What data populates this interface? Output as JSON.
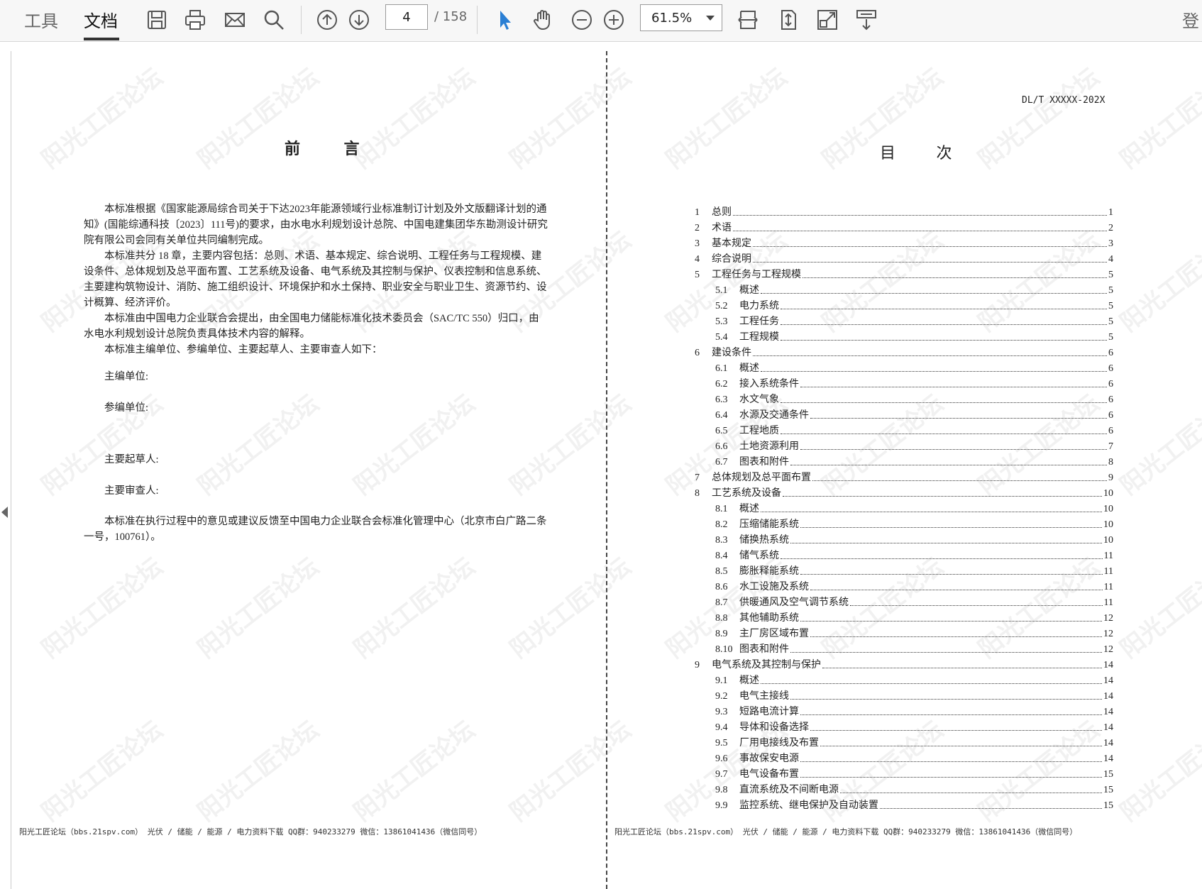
{
  "toolbar": {
    "tab_tools": "工具",
    "tab_document": "文档",
    "page_current": "4",
    "page_total": "/ 158",
    "zoom": "61.5%",
    "login": "登"
  },
  "icons": [
    "save-icon",
    "print-icon",
    "mail-icon",
    "search-icon",
    "prev-page-icon",
    "next-page-icon",
    "pointer-icon",
    "hand-icon",
    "zoom-out-icon",
    "zoom-in-icon",
    "fit-width-icon",
    "fit-page-icon",
    "fullscreen-icon",
    "scroll-icon"
  ],
  "left_page": {
    "title": "前 言",
    "paragraphs": [
      "本标准根据《国家能源局综合司关于下达2023年能源领域行业标准制订计划及外文版翻译计划的通知》(国能综通科技〔2023〕111号)的要求，由水电水利规划设计总院、中国电建集团华东勘测设计研究院有限公司会同有关单位共同编制完成。",
      "本标准共分 18 章，主要内容包括：总则、术语、基本规定、综合说明、工程任务与工程规模、建设条件、总体规划及总平面布置、工艺系统及设备、电气系统及其控制与保护、仪表控制和信息系统、主要建构筑物设计、消防、施工组织设计、环境保护和水土保持、职业安全与职业卫生、资源节约、设计概算、经济评价。",
      "本标准由中国电力企业联合会提出，由全国电力储能标准化技术委员会（SAC/TC 550）归口，由水电水利规划设计总院负责具体技术内容的解释。",
      "本标准主编单位、参编单位、主要起草人、主要审查人如下："
    ],
    "label_chief_unit": "主编单位:",
    "label_participating_units": "参编单位:",
    "label_drafters": "主要起草人:",
    "label_reviewers": "主要审查人:",
    "feedback": "本标准在执行过程中的意见或建议反馈至中国电力企业联合会标准化管理中心（北京市白广路二条一号，100761）。",
    "footer": "阳光工匠论坛（bbs.21spv.com）   光伏 / 储能 / 能源 / 电力资料下载   QQ群：940233279      微信：13861041436（微信同号）"
  },
  "right_page": {
    "std_no": "DL/T XXXXX-202X",
    "title": "目 次",
    "toc": [
      {
        "num": "1",
        "title": "总则",
        "page": "1",
        "level": 1
      },
      {
        "num": "2",
        "title": "术语",
        "page": "2",
        "level": 1
      },
      {
        "num": "3",
        "title": "基本规定",
        "page": "3",
        "level": 1
      },
      {
        "num": "4",
        "title": "综合说明",
        "page": "4",
        "level": 1
      },
      {
        "num": "5",
        "title": "工程任务与工程规模",
        "page": "5",
        "level": 1
      },
      {
        "num": "5.1",
        "title": "概述",
        "page": "5",
        "level": 2
      },
      {
        "num": "5.2",
        "title": "电力系统",
        "page": "5",
        "level": 2
      },
      {
        "num": "5.3",
        "title": "工程任务",
        "page": "5",
        "level": 2
      },
      {
        "num": "5.4",
        "title": "工程规模",
        "page": "5",
        "level": 2
      },
      {
        "num": "6",
        "title": "建设条件",
        "page": "6",
        "level": 1
      },
      {
        "num": "6.1",
        "title": "概述",
        "page": "6",
        "level": 2
      },
      {
        "num": "6.2",
        "title": "接入系统条件",
        "page": "6",
        "level": 2
      },
      {
        "num": "6.3",
        "title": "水文气象",
        "page": "6",
        "level": 2
      },
      {
        "num": "6.4",
        "title": "水源及交通条件",
        "page": "6",
        "level": 2
      },
      {
        "num": "6.5",
        "title": "工程地质",
        "page": "6",
        "level": 2
      },
      {
        "num": "6.6",
        "title": "土地资源利用",
        "page": "7",
        "level": 2
      },
      {
        "num": "6.7",
        "title": "图表和附件",
        "page": "8",
        "level": 2
      },
      {
        "num": "7",
        "title": "总体规划及总平面布置",
        "page": "9",
        "level": 1
      },
      {
        "num": "8",
        "title": "工艺系统及设备",
        "page": "10",
        "level": 1
      },
      {
        "num": "8.1",
        "title": "概述",
        "page": "10",
        "level": 2
      },
      {
        "num": "8.2",
        "title": "压缩储能系统",
        "page": "10",
        "level": 2
      },
      {
        "num": "8.3",
        "title": "储换热系统",
        "page": "10",
        "level": 2
      },
      {
        "num": "8.4",
        "title": "储气系统",
        "page": "11",
        "level": 2
      },
      {
        "num": "8.5",
        "title": "膨胀释能系统",
        "page": "11",
        "level": 2
      },
      {
        "num": "8.6",
        "title": "水工设施及系统",
        "page": "11",
        "level": 2
      },
      {
        "num": "8.7",
        "title": "供暖通风及空气调节系统",
        "page": "11",
        "level": 2
      },
      {
        "num": "8.8",
        "title": "其他辅助系统",
        "page": "12",
        "level": 2
      },
      {
        "num": "8.9",
        "title": "主厂房区域布置",
        "page": "12",
        "level": 2
      },
      {
        "num": "8.10",
        "title": "图表和附件",
        "page": "12",
        "level": 2
      },
      {
        "num": "9",
        "title": "电气系统及其控制与保护",
        "page": "14",
        "level": 1
      },
      {
        "num": "9.1",
        "title": "概述",
        "page": "14",
        "level": 2
      },
      {
        "num": "9.2",
        "title": "电气主接线",
        "page": "14",
        "level": 2
      },
      {
        "num": "9.3",
        "title": "短路电流计算",
        "page": "14",
        "level": 2
      },
      {
        "num": "9.4",
        "title": "导体和设备选择",
        "page": "14",
        "level": 2
      },
      {
        "num": "9.5",
        "title": "厂用电接线及布置",
        "page": "14",
        "level": 2
      },
      {
        "num": "9.6",
        "title": "事故保安电源",
        "page": "14",
        "level": 2
      },
      {
        "num": "9.7",
        "title": "电气设备布置",
        "page": "15",
        "level": 2
      },
      {
        "num": "9.8",
        "title": "直流系统及不间断电源",
        "page": "15",
        "level": 2
      },
      {
        "num": "9.9",
        "title": "监控系统、继电保护及自动装置",
        "page": "15",
        "level": 2
      }
    ],
    "footer": "阳光工匠论坛（bbs.21spv.com）   光伏 / 储能 / 能源 / 电力资料下载   QQ群：940233279      微信：13861041436（微信同号）"
  },
  "watermark": "阳光工匠论坛"
}
